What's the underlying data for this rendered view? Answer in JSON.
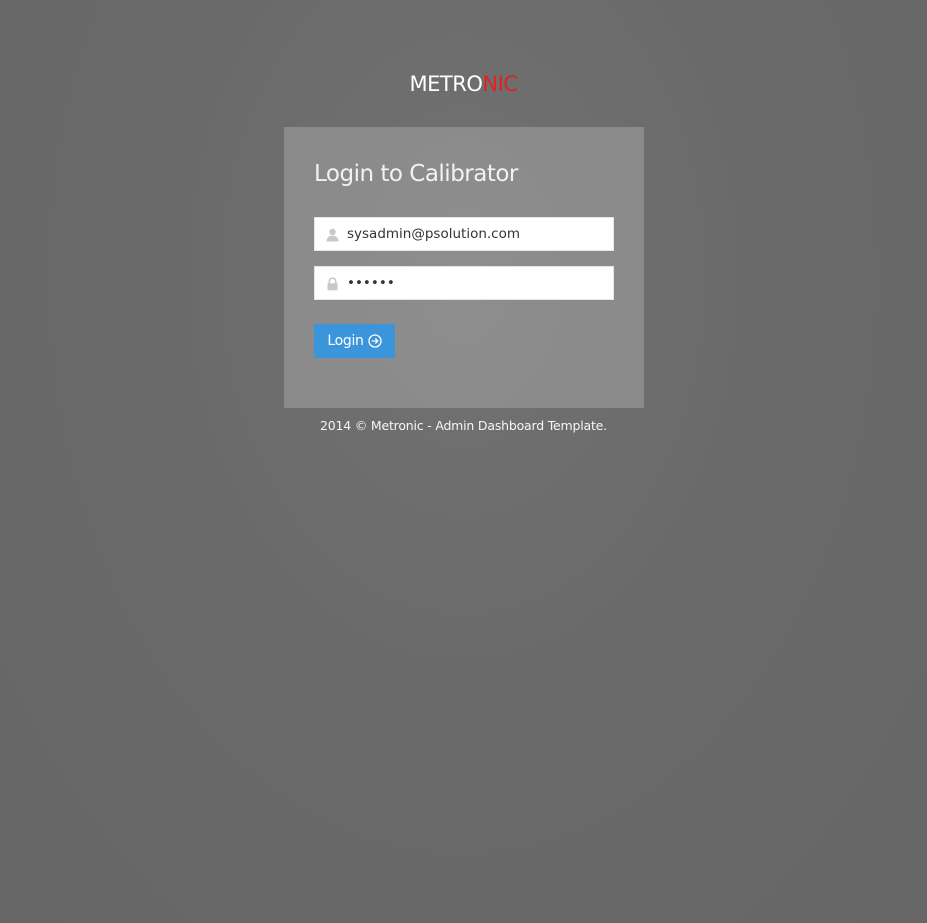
{
  "logo": {
    "part1": "METRO",
    "part2": "NIC",
    "part1_color": "#ffffff",
    "part2_color": "#e02222"
  },
  "login_form": {
    "title": "Login to Calibrator",
    "email": {
      "value": "sysadmin@psolution.com",
      "icon": "user-icon"
    },
    "password": {
      "value": "••••••",
      "icon": "lock-icon"
    },
    "submit": {
      "label": "Login",
      "icon": "arrow-circle-right-icon",
      "color": "#3b95db"
    }
  },
  "footer": {
    "text": "2014 © Metronic - Admin Dashboard Template."
  }
}
